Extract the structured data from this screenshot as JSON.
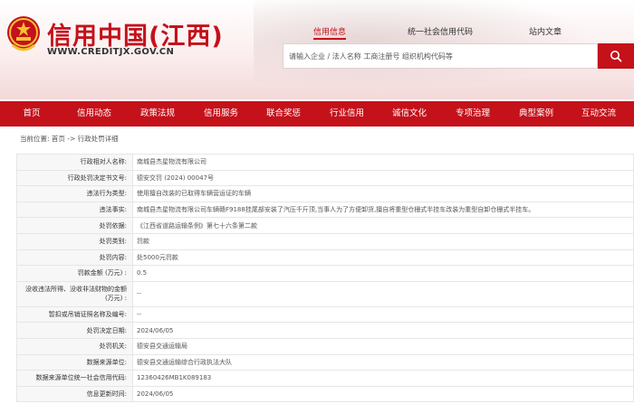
{
  "header": {
    "title": "信用中国(江西)",
    "url": "WWW.CREDITJX.GOV.CN",
    "links": [
      "信用信息",
      "统一社会信用代码",
      "站内文章"
    ],
    "active_link": "信用信息",
    "search": {
      "placeholder": "请输入企业 / 法人名称 工商注册号 组织机构代码等"
    }
  },
  "nav": {
    "items": [
      "首页",
      "信用动态",
      "政策法规",
      "信用服务",
      "联合奖惩",
      "行业信用",
      "诚信文化",
      "专项治理",
      "典型案例",
      "互动交流"
    ]
  },
  "breadcrumb": "当前位置: 首页 -> 行政处罚详细",
  "details": [
    {
      "label": "行政相对人名称:",
      "value": "南城县杰星物流有限公司"
    },
    {
      "label": "行政处罚决定书文号:",
      "value": "德安交罚 (2024) 00047号"
    },
    {
      "label": "违法行为类型:",
      "value": "使用擅自改装的已取得车辆营运证的车辆"
    },
    {
      "label": "违法事实:",
      "value": "南城县杰星物流有限公司车辆赣F9188挂尾部安装了汽压千斤顶,当事人为了方便卸货,擅自将重型仓栅式半挂车改装为重型自卸仓栅式半挂车。"
    },
    {
      "label": "处罚依据:",
      "value": "《江西省道路运输条例》第七十六条第二款"
    },
    {
      "label": "处罚类别:",
      "value": "罚款"
    },
    {
      "label": "处罚内容:",
      "value": "处5000元罚款"
    },
    {
      "label": "罚款金额 (万元) :",
      "value": "0.5"
    },
    {
      "label": "没收违法所得、没收非法财物的金额 (万元) :",
      "value": "--"
    },
    {
      "label": "暂扣或吊销证照名称及编号:",
      "value": "--"
    },
    {
      "label": "处罚决定日期:",
      "value": "2024/06/05"
    },
    {
      "label": "处罚机关:",
      "value": "德安县交通运输局"
    },
    {
      "label": "数据来源单位:",
      "value": "德安县交通运输综合行政执法大队"
    },
    {
      "label": "数据来源单位统一社会信用代码:",
      "value": "12360426MB1K089183"
    },
    {
      "label": "信息更新时间:",
      "value": "2024/06/05"
    }
  ],
  "colors": {
    "brand_red": "#c4111a"
  },
  "icons": {
    "emblem": "national-emblem-icon",
    "search": "search-icon"
  }
}
